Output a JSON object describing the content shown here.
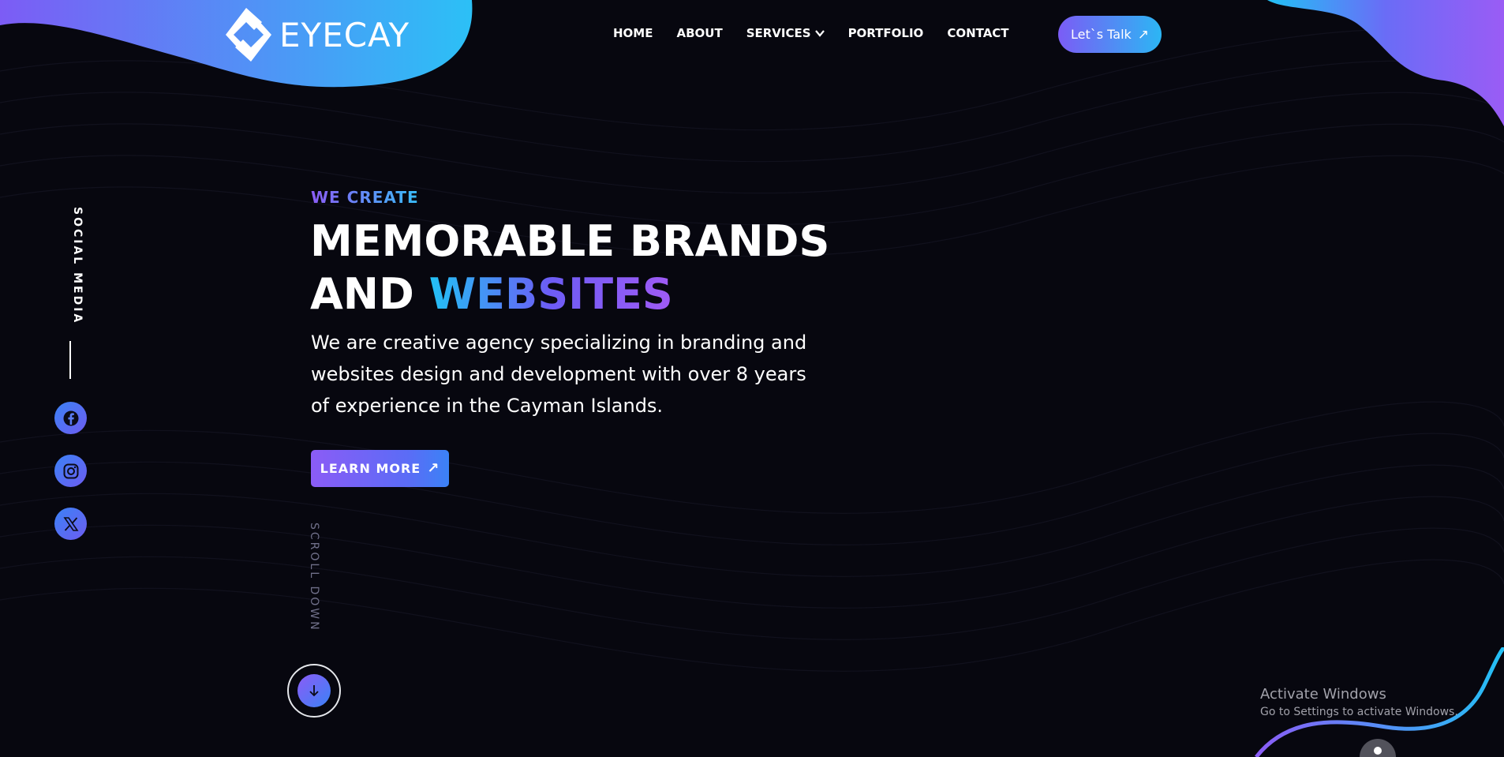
{
  "brand": {
    "name": "EYECAY",
    "logo_icon": "eyecay-logo-icon"
  },
  "nav": {
    "items": [
      {
        "label": "HOME"
      },
      {
        "label": "ABOUT"
      },
      {
        "label": "SERVICES",
        "has_dropdown": true
      },
      {
        "label": "PORTFOLIO"
      },
      {
        "label": "CONTACT"
      }
    ],
    "cta_label": "Let`s Talk",
    "cta_icon": "arrow-up-right-icon"
  },
  "social": {
    "label": "SOCIAL MEDIA",
    "links": [
      {
        "icon": "facebook-icon"
      },
      {
        "icon": "instagram-icon"
      },
      {
        "icon": "x-twitter-icon"
      }
    ]
  },
  "hero": {
    "eyebrow": "WE CREATE",
    "headline_line1": "MEMORABLE BRANDS",
    "headline_line2_plain": "AND ",
    "headline_line2_accent": "WEBSITES",
    "description": "We are creative agency specializing in branding and websites design and development with over 8 years of experience in the Cayman Islands.",
    "button_label": "LEARN MORE",
    "button_icon": "arrow-up-right-icon"
  },
  "scroll": {
    "label": "SCROLL DOWN",
    "icon": "arrow-down-icon"
  },
  "watermark": {
    "title": "Activate Windows",
    "subtitle": "Go to Settings to activate Windows."
  },
  "colors": {
    "background": "#07070f",
    "gradient_start": "#8b5cf6",
    "gradient_end": "#2cb6f4",
    "text": "#ffffff",
    "muted": "#70708a"
  }
}
